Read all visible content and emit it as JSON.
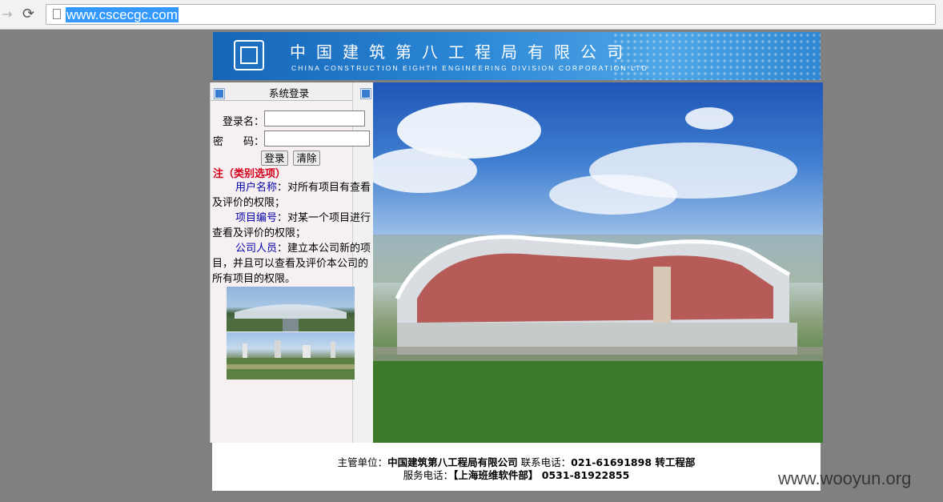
{
  "browser": {
    "url": "www.cscecgc.com"
  },
  "banner": {
    "company_cn": "中国建筑第八工程局有限公司",
    "company_en": "CHINA CONSTRUCTION EIGHTH ENGINEERING DIVISION CORPORATION LTD"
  },
  "login": {
    "title": "系统登录",
    "username_label": "登录名：",
    "password_label_1": "密",
    "password_label_2": "码：",
    "username_value": "",
    "password_value": "",
    "login_button": "登录",
    "clear_button": "清除"
  },
  "notes": {
    "title": "注（类别选项）",
    "items": [
      {
        "keyword": "用户名称",
        "text_first": "：对所有项目有查看",
        "text_rest": "及评价的权限；"
      },
      {
        "keyword": "项目编号",
        "text_first": "：对某一个项目进行",
        "text_rest": "查看及评价的权限；"
      },
      {
        "keyword": "公司人员",
        "text_first": "：建立本公司新的项",
        "text_rest": "目，并且可以查看及评价本公司的所有项目的权限。"
      }
    ]
  },
  "footer": {
    "host_label": "主管单位：",
    "host_value": "中国建筑第八工程局有限公司",
    "phone_label": "联系电话：",
    "phone_value": "021-61691898 转工程部",
    "service_label": "服务电话：",
    "service_value": "【上海班维软件部】 0531-81922855"
  },
  "watermark": "www.wooyun.org",
  "colors": {
    "accent_blue": "#2a85d4",
    "note_red": "#d4001a",
    "keyword_blue": "#0000a8"
  }
}
